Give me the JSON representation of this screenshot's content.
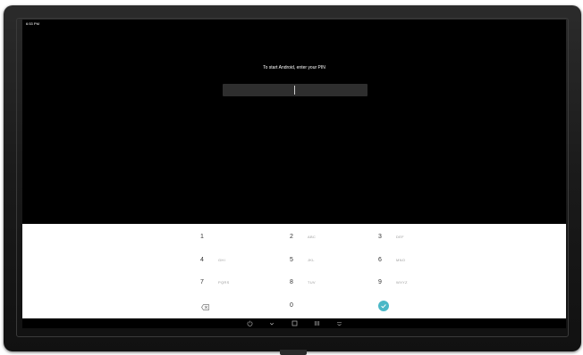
{
  "status_bar": {
    "time": "6:53 PM"
  },
  "lock": {
    "prompt": "To start Android, enter your PIN"
  },
  "keypad": {
    "keys": [
      {
        "digit": "1",
        "letters": ""
      },
      {
        "digit": "2",
        "letters": "ABC"
      },
      {
        "digit": "3",
        "letters": "DEF"
      },
      {
        "digit": "4",
        "letters": "GHI"
      },
      {
        "digit": "5",
        "letters": "JKL"
      },
      {
        "digit": "6",
        "letters": "MNO"
      },
      {
        "digit": "7",
        "letters": "PQRS"
      },
      {
        "digit": "8",
        "letters": "TUV"
      },
      {
        "digit": "9",
        "letters": "WXYZ"
      },
      {
        "digit": "0",
        "letters": ""
      }
    ],
    "backspace_icon": "backspace-icon",
    "confirm_icon": "check-icon",
    "accent_color": "#4bb8c7"
  },
  "navbar": {
    "icons": [
      "power-icon",
      "chevron-down-icon",
      "square-icon",
      "recents-icon",
      "ime-switch-icon"
    ]
  }
}
